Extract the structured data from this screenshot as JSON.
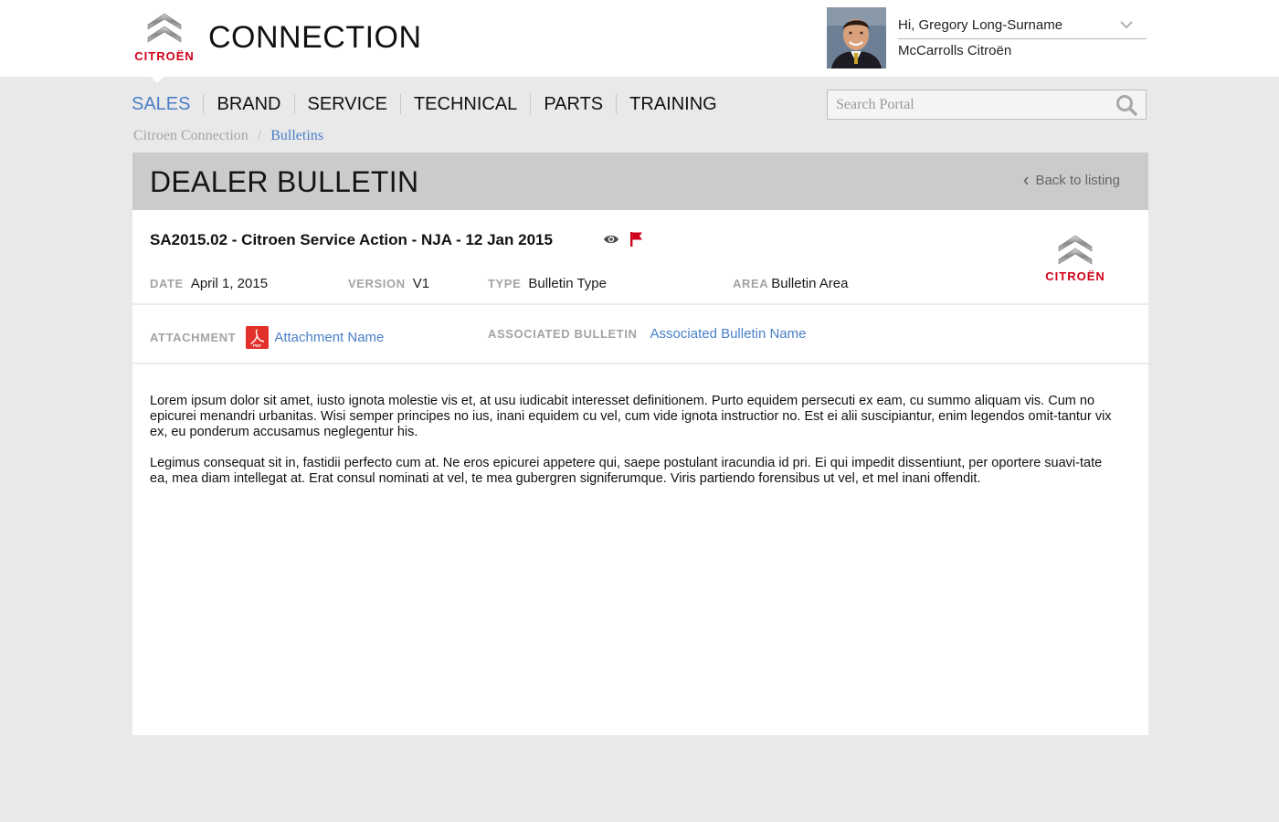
{
  "brand": {
    "logo_word": "CITROËN",
    "accent_color": "#d0021b",
    "link_color": "#4a7fc8"
  },
  "app": {
    "title": "CONNECTION"
  },
  "user": {
    "greeting": "Hi, Gregory Long-Surname",
    "dealer": "McCarrolls Citroën"
  },
  "nav": {
    "items": [
      {
        "label": "SALES",
        "active": true
      },
      {
        "label": "BRAND",
        "active": false
      },
      {
        "label": "SERVICE",
        "active": false
      },
      {
        "label": "TECHNICAL",
        "active": false
      },
      {
        "label": "PARTS",
        "active": false
      },
      {
        "label": "TRAINING",
        "active": false
      }
    ]
  },
  "search": {
    "placeholder": "Search Portal",
    "icon": "search-icon"
  },
  "breadcrumb": {
    "root": "Citroen Connection",
    "separator": "/",
    "current": "Bulletins"
  },
  "page": {
    "title": "DEALER BULLETIN",
    "back_label": "Back to listing"
  },
  "bulletin": {
    "title": "SA2015.02 - Citroen Service Action - NJA - 12 Jan 2015",
    "meta": {
      "date_label": "DATE",
      "date": "April 1, 2015",
      "version_label": "VERSION",
      "version": "V1",
      "type_label": "TYPE",
      "type": "Bulletin Type",
      "area_label": "AREA",
      "area": "Bulletin Area"
    },
    "attachment_label": "ATTACHMENT",
    "attachment_name": "Attachment Name",
    "associated_label": "ASSOCIATED BULLETIN",
    "associated_name": "Associated Bulletin Name",
    "body": [
      "Lorem ipsum dolor sit amet, iusto ignota molestie vis et, at usu iudicabit interesset definitionem. Purto equidem persecuti ex eam, cu summo aliquam vis. Cum no epicurei menandri urbanitas. Wisi semper principes no ius, inani equidem cu vel, cum vide ignota instructior no. Est ei alii suscipiantur, enim legendos omit-tantur vix ex, eu ponderum accusamus neglegentur his.",
      "Legimus consequat sit in, fastidii perfecto cum at. Ne eros epicurei appetere qui, saepe postulant iracundia id pri. Ei qui impedit dissentiunt, per oportere suavi-tate ea, mea diam intellegat at. Erat consul nominati at vel, te mea gubergren signiferumque. Viris partiendo forensibus ut vel, et mel inani offendit."
    ]
  }
}
